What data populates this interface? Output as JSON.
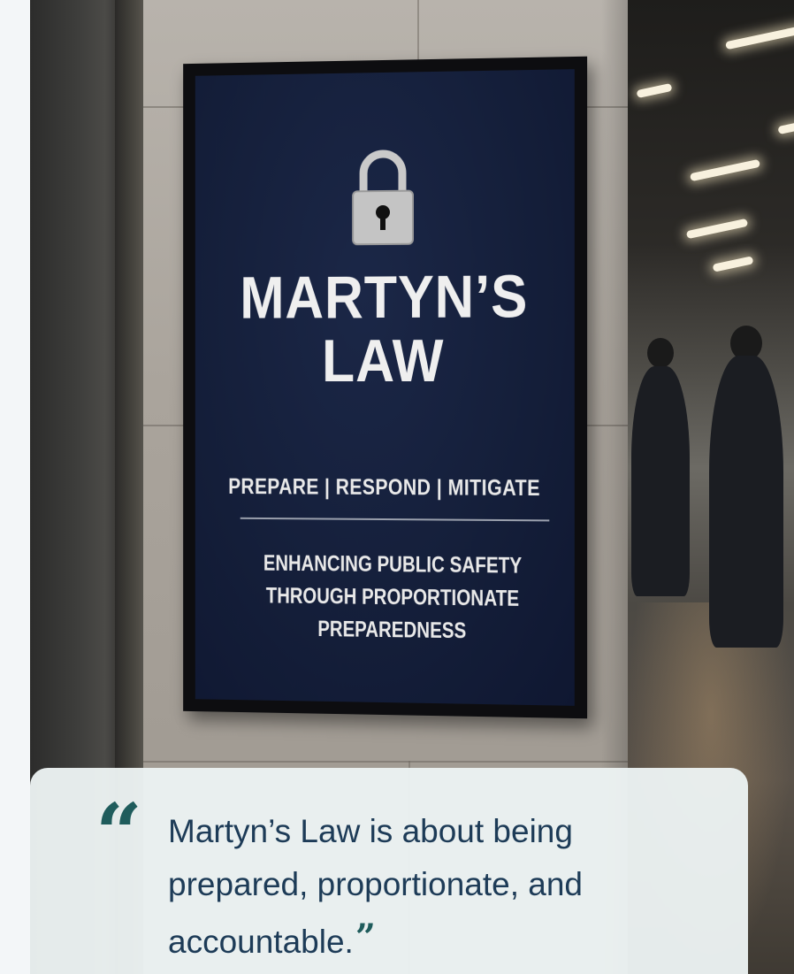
{
  "sign": {
    "icon": "padlock-icon",
    "title": "MARTYN’S LAW",
    "tagline": "PREPARE | RESPOND | MITIGATE",
    "subtitle": "ENHANCING PUBLIC SAFETY THROUGH PROPORTIONATE PREPAREDNESS"
  },
  "quote": {
    "text": "Martyn’s Law is about being prepared, proportionate, and accountable.",
    "open_mark": "“",
    "close_mark": "”",
    "color_text": "#1d3b57",
    "color_marks": "#1f5c5c"
  },
  "colors": {
    "sign_background": "#141e39",
    "card_background": "#ecf2f3"
  }
}
